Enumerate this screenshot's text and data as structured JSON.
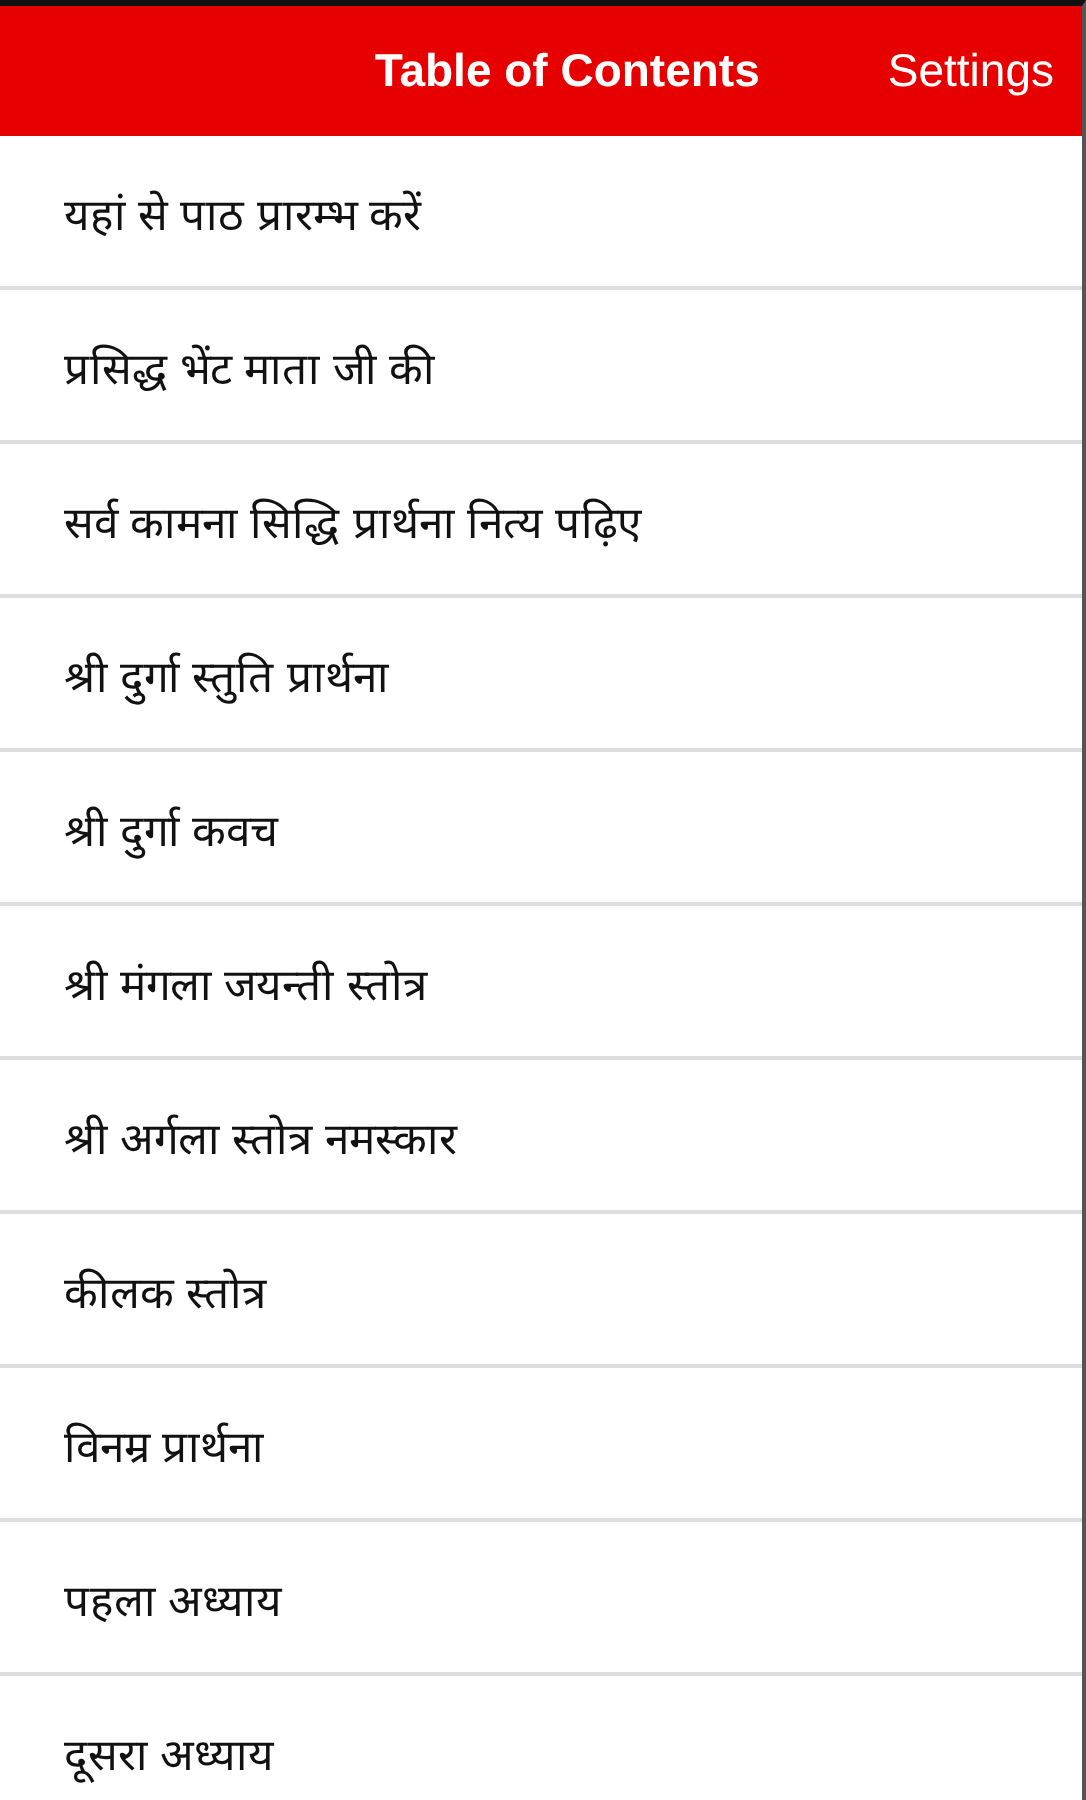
{
  "header": {
    "title": "Table of Contents",
    "action": "Settings"
  },
  "items": [
    "यहां से पाठ प्रारम्भ करें",
    "प्रसिद्ध भेंट माता जी की",
    "सर्व कामना सिद्धि प्रार्थना नित्य पढ़िए",
    "श्री दुर्गा स्तुति प्रार्थना",
    "श्री दुर्गा कवच",
    "श्री मंगला जयन्ती स्तोत्र",
    "श्री अर्गला स्तोत्र नमस्कार",
    "कीलक स्तोत्र",
    "विनम्र प्रार्थना",
    "पहला अध्याय",
    "दूसरा अध्याय"
  ]
}
